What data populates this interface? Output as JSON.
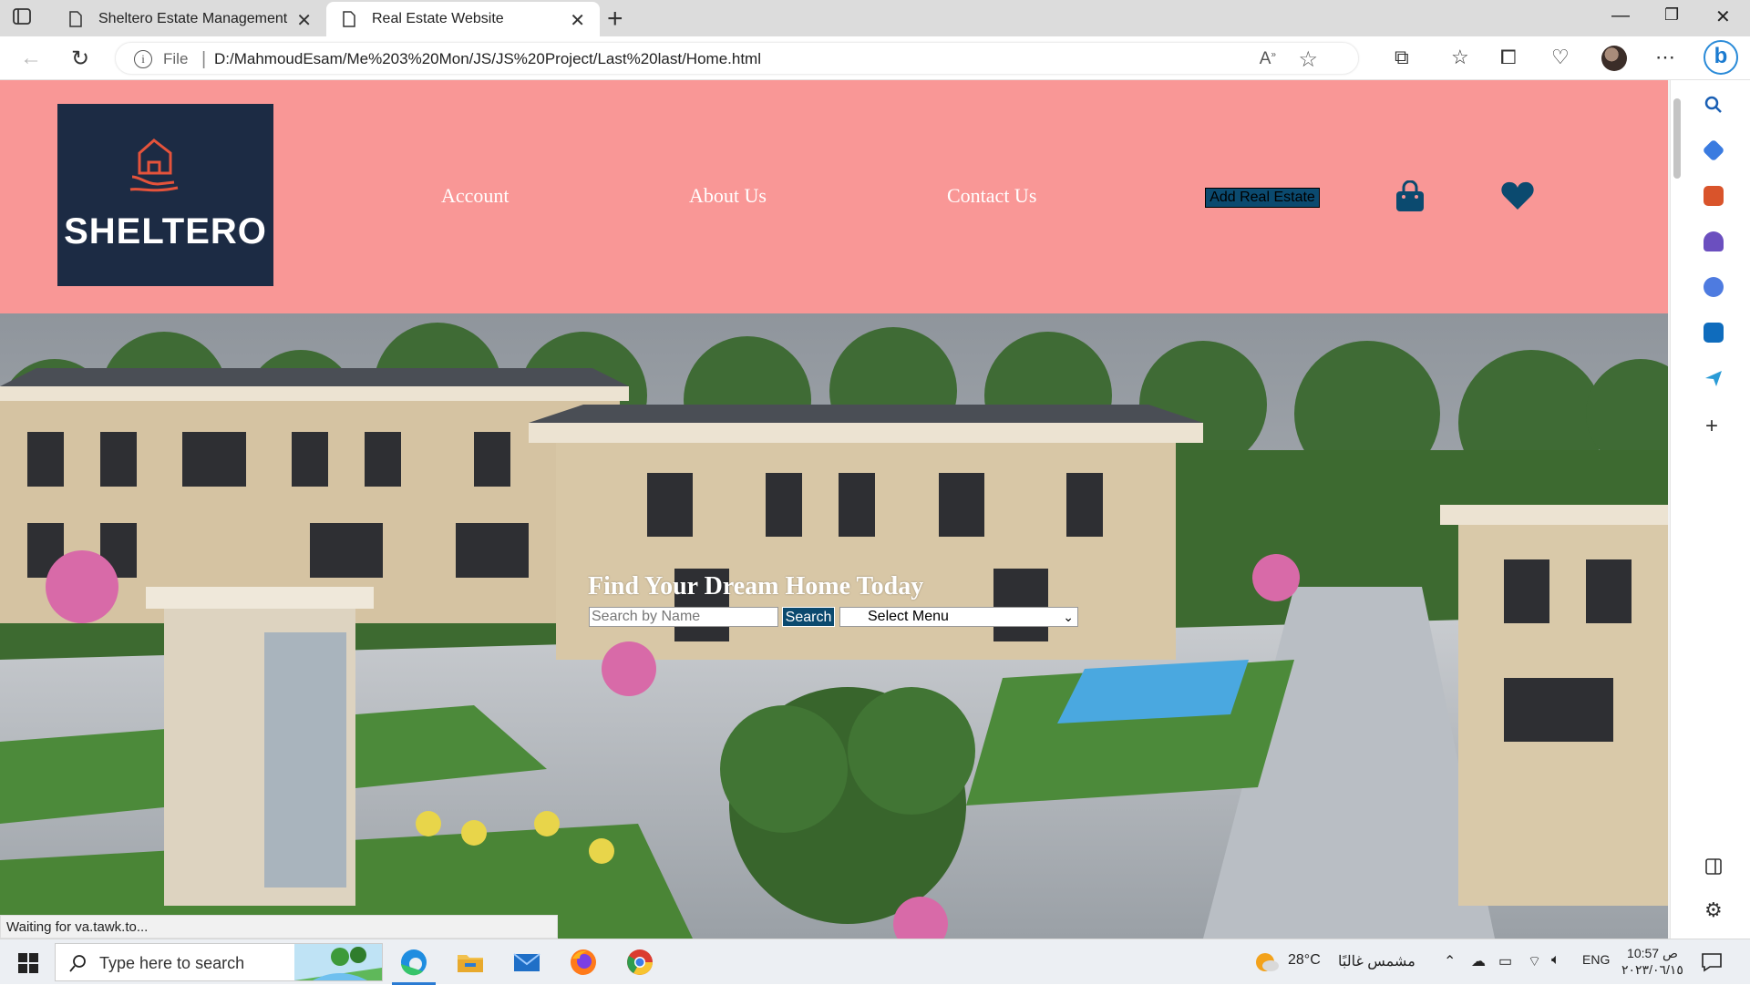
{
  "browser": {
    "tabs": [
      {
        "title": "Sheltero Estate Management",
        "active": false
      },
      {
        "title": "Real Estate Website",
        "active": true
      }
    ],
    "address": {
      "scheme_label": "File",
      "url": "D:/MahmoudEsam/Me%203%20Mon/JS/JS%20Project/Last%20last/Home.html"
    },
    "status_text": "Waiting for va.tawk.to..."
  },
  "site": {
    "logo_text": "SHELTERO",
    "nav": {
      "account": "Account",
      "about": "About Us",
      "contact": "Contact Us",
      "add_real_estate": "Add Real Estate"
    },
    "hero": {
      "title": "Find Your Dream Home Today",
      "search_placeholder": "Search by Name",
      "search_button": "Search",
      "select_value": "Select Menu"
    }
  },
  "taskbar": {
    "search_placeholder": "Type here to search",
    "weather_temp": "28°C",
    "weather_desc": "مشمس غالبًا",
    "lang": "ENG",
    "time": "10:57 ص",
    "date": "٢٠٢٣/٠٦/١٥"
  },
  "colors": {
    "header_bg": "#f99796",
    "logo_bg": "#1c2b44",
    "accent": "#0b4a6f"
  }
}
